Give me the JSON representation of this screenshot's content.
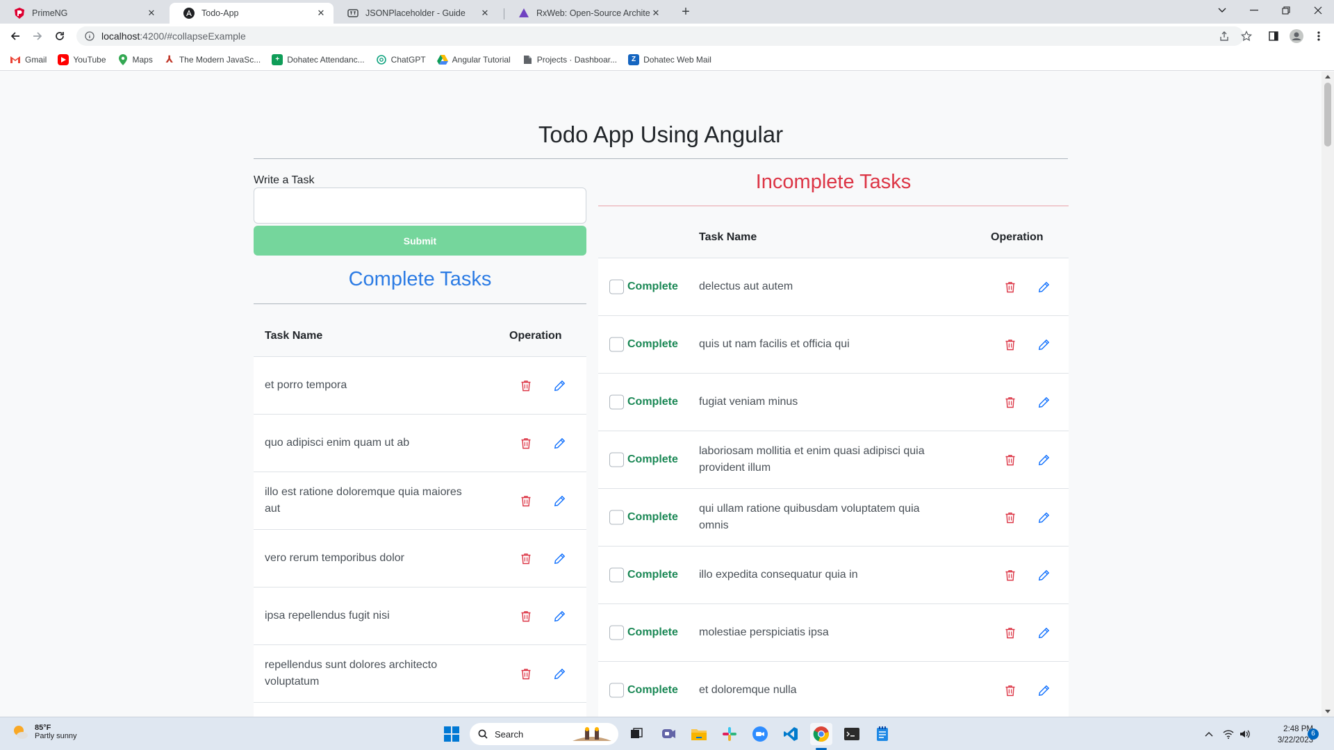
{
  "browser": {
    "tabs": [
      {
        "title": "PrimeNG",
        "icon": "primeng-icon"
      },
      {
        "title": "Todo-App",
        "icon": "angular-icon",
        "active": true
      },
      {
        "title": "JSONPlaceholder - Guide",
        "icon": "jsonplaceholder-icon"
      },
      {
        "title": "RxWeb: Open-Source Architectur",
        "icon": "rxweb-icon"
      }
    ],
    "url_host": "localhost",
    "url_path": ":4200/#collapseExample",
    "bookmarks": [
      {
        "label": "Gmail",
        "icon": "gmail-icon"
      },
      {
        "label": "YouTube",
        "icon": "youtube-icon"
      },
      {
        "label": "Maps",
        "icon": "maps-icon"
      },
      {
        "label": "The Modern JavaSc...",
        "icon": "javascript-info-icon"
      },
      {
        "label": "Dohatec Attendanc...",
        "icon": "attendance-icon"
      },
      {
        "label": "ChatGPT",
        "icon": "chatgpt-icon"
      },
      {
        "label": "Angular Tutorial",
        "icon": "drive-icon"
      },
      {
        "label": "Projects · Dashboar...",
        "icon": "projects-icon"
      },
      {
        "label": "Dohatec Web Mail",
        "icon": "zimbra-icon"
      }
    ]
  },
  "app": {
    "title": "Todo App Using Angular",
    "form": {
      "label": "Write a Task",
      "value": "",
      "submit": "Submit"
    },
    "complete": {
      "title": "Complete Tasks",
      "col_task": "Task Name",
      "col_op": "Operation",
      "rows": [
        "et porro tempora",
        "quo adipisci enim quam ut ab",
        "illo est ratione doloremque quia maiores aut",
        "vero rerum temporibus dolor",
        "ipsa repellendus fugit nisi",
        "repellendus sunt dolores architecto voluptatum"
      ]
    },
    "incomplete": {
      "title": "Incomplete Tasks",
      "col_task": "Task Name",
      "col_op": "Operation",
      "complete_label": "Complete",
      "rows": [
        "delectus aut autem",
        "quis ut nam facilis et officia qui",
        "fugiat veniam minus",
        "laboriosam mollitia et enim quasi adipisci quia provident illum",
        "qui ullam ratione quibusdam voluptatem quia omnis",
        "illo expedita consequatur quia in",
        "molestiae perspiciatis ipsa",
        "et doloremque nulla"
      ]
    }
  },
  "colors": {
    "complete_title": "#2b7be4",
    "incomplete_title": "#dc3545",
    "submit_bg": "#75d69c",
    "delete_icon": "#dc3545",
    "edit_icon": "#0d6efd",
    "complete_label": "#198754"
  },
  "taskbar": {
    "weather_temp": "85°F",
    "weather_desc": "Partly sunny",
    "search_placeholder": "Search",
    "time": "2:48 PM",
    "date": "3/22/2023",
    "notifications": "6"
  }
}
